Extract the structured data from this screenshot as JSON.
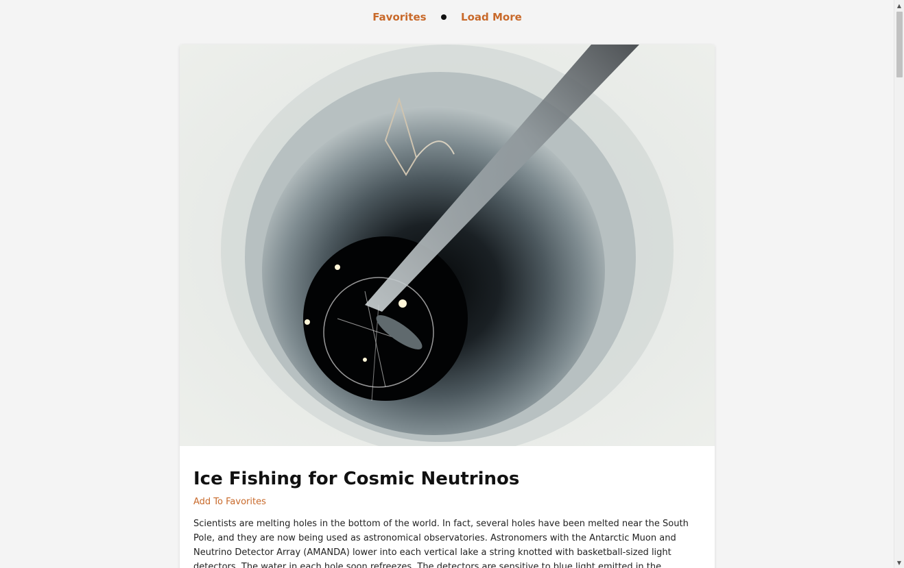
{
  "nav": {
    "favorites_label": "Favorites",
    "load_more_label": "Load More",
    "accent_color": "#c8692a"
  },
  "card": {
    "image_icon": "ice-borehole-photo",
    "title": "Ice Fishing for Cosmic Neutrinos",
    "add_favorites_label": "Add To Favorites",
    "explanation": "Scientists are melting holes in the bottom of the world. In fact, several holes have been melted near the South Pole, and they are now being used as astronomical observatories. Astronomers with the Antarctic Muon and Neutrino Detector Array (AMANDA) lower into each vertical lake a string knotted with basketball-sized light detectors. The water in each hole soon refreezes. The detectors are sensitive to blue light emitted in the surrounding clear ice. Such light is expected"
  },
  "scrollbar": {
    "up_icon": "scroll-up-arrow-icon",
    "down_icon": "scroll-down-arrow-icon"
  }
}
